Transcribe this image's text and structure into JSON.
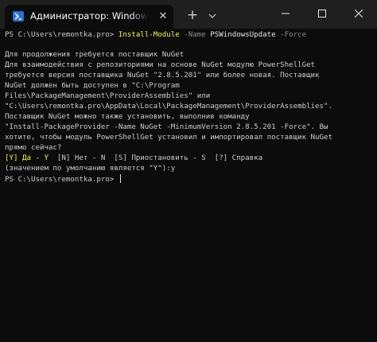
{
  "titlebar": {
    "tab_title": "Администратор: Windows PowerShell",
    "close_tab_glyph": "✕",
    "new_tab_glyph": "+",
    "dropdown_glyph": "⌄"
  },
  "console": {
    "prompt_line": {
      "prompt": "PS C:\\Users\\remontka.pro> ",
      "command": "Install-Module",
      "param1": " -Name ",
      "arg1": "PSWindowsUpdate",
      "param2": " -Force"
    },
    "message_lines": [
      "Для продолжения требуется поставщик NuGet",
      "Для взаимодействия с репозиториями на основе NuGet модулю PowerShellGet",
      "требуется версия поставщика NuGet \"2.8.5.201\" или более новая. Поставщик",
      "NuGet должен быть доступен в \"C:\\Program",
      "Files\\PackageManagement\\ProviderAssemblies\" или",
      "\"C:\\Users\\remontka.pro\\AppData\\Local\\PackageManagement\\ProviderAssemblies\".",
      "Поставщик NuGet можно также установить, выполнив команду",
      "\"Install-PackageProvider -Name NuGet -MinimumVersion 2.8.5.201 -Force\". Вы",
      "хотите, чтобы модуль PowerShellGet установил и импортировал поставщик NuGet",
      "прямо сейчас?"
    ],
    "choice_line": {
      "yes": "[Y] Да - Y",
      "rest": "  [N] Нет - N  [S] Приостановить - S  [?] Справка"
    },
    "default_line": "(значением по умолчанию является \"Y\"):y",
    "final_prompt": "PS C:\\Users\\remontka.pro> "
  },
  "colors": {
    "background": "#0c0c0c",
    "titlebar": "#1f1f1f",
    "text": "#cccccc",
    "highlight_yellow": "#f2f263",
    "parameter_gray": "#8a8a8a"
  },
  "icons": [
    "powershell-icon",
    "close-icon",
    "plus-icon",
    "chevron-down-icon",
    "minimize-icon",
    "maximize-icon",
    "close-window-icon"
  ]
}
